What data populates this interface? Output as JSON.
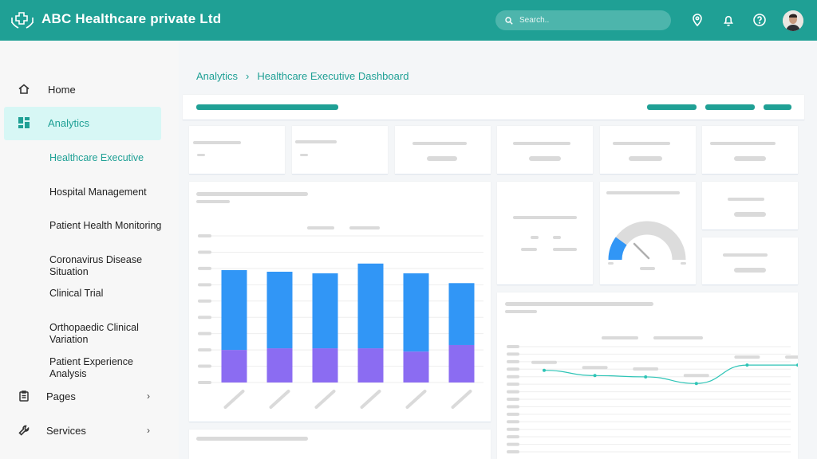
{
  "app": {
    "title": "ABC Healthcare private Ltd",
    "brand_color": "#1fa095"
  },
  "search": {
    "placeholder": "Search.."
  },
  "topbar_icons": [
    "location-pin-icon",
    "bell-icon",
    "help-icon"
  ],
  "sidebar": {
    "items": [
      {
        "label": "Home",
        "icon": "home-icon"
      },
      {
        "label": "Analytics",
        "icon": "dashboard-grid-icon",
        "active": true
      },
      {
        "label": "Pages",
        "icon": "clipboard-icon"
      },
      {
        "label": "Services",
        "icon": "wrench-icon"
      }
    ],
    "analytics_sub": [
      "Healthcare Executive",
      "Hospital Management",
      "Patient Health Monitoring",
      "Coronavirus Disease Situation",
      "Clinical Trial",
      "Orthopaedic Clinical Variation",
      "Patient Experience Analysis"
    ]
  },
  "breadcrumb": {
    "parent": "Analytics",
    "separator": "›",
    "current": "Healthcare Executive Dashboard"
  },
  "chart_data": [
    {
      "type": "bar",
      "stacked": true,
      "categories": [
        "",
        "",
        "",
        "",
        "",
        ""
      ],
      "series": [
        {
          "values": [
            2.0,
            2.1,
            2.1,
            2.1,
            1.9,
            2.3
          ],
          "color": "#8b6cf2"
        },
        {
          "values": [
            4.9,
            4.7,
            4.6,
            5.2,
            4.8,
            3.8
          ],
          "color": "#3196f6"
        }
      ],
      "ylim": [
        0,
        9
      ]
    },
    {
      "type": "line",
      "x": [
        1,
        2,
        3,
        4,
        5,
        6
      ],
      "series": [
        {
          "values": [
            6.2,
            5.8,
            5.7,
            5.2,
            6.6,
            6.6
          ],
          "color": "#2ec4b6"
        }
      ],
      "ylim": [
        0,
        8
      ]
    },
    {
      "type": "gauge",
      "value": 0.2,
      "colors": {
        "fill": "#3196f6",
        "track": "#dcdcdc"
      }
    }
  ]
}
